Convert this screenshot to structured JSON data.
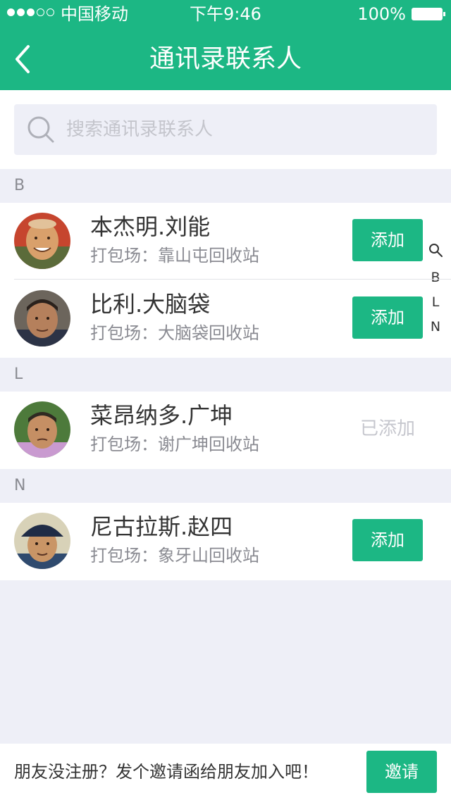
{
  "status_bar": {
    "carrier": "中国移动",
    "time": "下午9:46",
    "battery": "100%"
  },
  "header": {
    "title": "通讯录联系人",
    "back_icon": "chevron-left-icon"
  },
  "search": {
    "placeholder": "搜索通讯录联系人",
    "icon": "search-icon"
  },
  "sections": [
    {
      "letter": "B",
      "contacts": [
        {
          "name": "本杰明.刘能",
          "yard": "打包场：靠山屯回收站",
          "action": "添加",
          "added": false
        },
        {
          "name": "比利.大脑袋",
          "yard": "打包场：大脑袋回收站",
          "action": "添加",
          "added": false
        }
      ]
    },
    {
      "letter": "L",
      "contacts": [
        {
          "name": "菜昂纳多.广坤",
          "yard": "打包场：谢广坤回收站",
          "action": "已添加",
          "added": true
        }
      ]
    },
    {
      "letter": "N",
      "contacts": [
        {
          "name": "尼古拉斯.赵四",
          "yard": "打包场：象牙山回收站",
          "action": "添加",
          "added": false
        }
      ]
    }
  ],
  "index_bar": {
    "icon": "search-icon",
    "letters": [
      "B",
      "L",
      "N"
    ]
  },
  "footer": {
    "text": "朋友没注册？发个邀请函给朋友加入吧！",
    "invite_label": "邀请"
  },
  "colors": {
    "brand": "#1cb784",
    "background": "#eeeff7",
    "muted_text": "#8a8b92",
    "disabled_text": "#c6c7ce"
  }
}
